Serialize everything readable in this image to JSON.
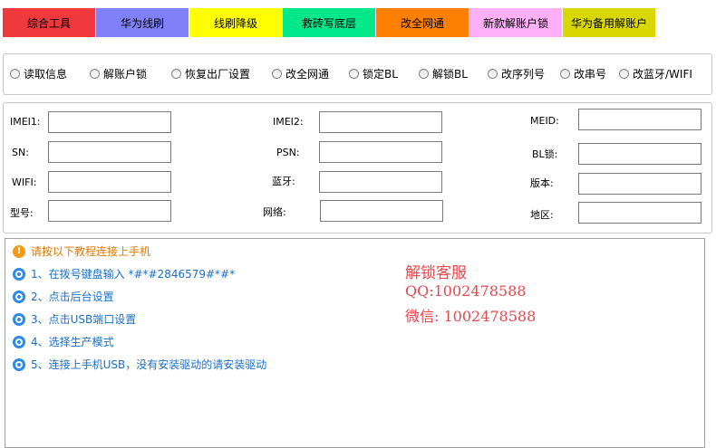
{
  "tabs": [
    {
      "label": "综合工具",
      "color": "#f0393c"
    },
    {
      "label": "华为线刷",
      "color": "#8080f8"
    },
    {
      "label": "线刷降级",
      "color": "#ffff00"
    },
    {
      "label": "救砖写底层",
      "color": "#00e88a"
    },
    {
      "label": "改全网通",
      "color": "#ff8000"
    },
    {
      "label": "新款解账户锁",
      "color": "#ffb0f8"
    },
    {
      "label": "华为备用解账户",
      "color": "#d8d800"
    }
  ],
  "options": [
    "读取信息",
    "解账户锁",
    "恢复出厂设置",
    "改全网通",
    "锁定BL",
    "解锁BL",
    "改序列号",
    "改串号",
    "改蓝牙/WIFI"
  ],
  "fields": {
    "imei1": {
      "label": "IMEI1:",
      "value": ""
    },
    "imei2": {
      "label": "IMEI2:",
      "value": ""
    },
    "meid": {
      "label": "MEID:",
      "value": ""
    },
    "sn": {
      "label": "SN:",
      "value": ""
    },
    "psn": {
      "label": "PSN:",
      "value": ""
    },
    "bl_lock": {
      "label": "BL锁:",
      "value": ""
    },
    "wifi": {
      "label": "WIFI:",
      "value": ""
    },
    "bluetooth": {
      "label": "蓝牙:",
      "value": ""
    },
    "version": {
      "label": "版本:",
      "value": ""
    },
    "model": {
      "label": "型号:",
      "value": ""
    },
    "network": {
      "label": "网络:",
      "value": ""
    },
    "region": {
      "label": "地区:",
      "value": ""
    }
  },
  "log": {
    "warning": "请按以下教程连接上手机",
    "steps": [
      "1、在拨号键盘输入 *#*#2846579#*#*",
      "2、点击后台设置",
      "3、点击USB端口设置",
      "4、选择生产模式",
      "5、连接上手机USB，没有安装驱动的请安装驱动"
    ],
    "contact": {
      "title": "解锁客服",
      "qq": "QQ:1002478588",
      "wechat": "微信: 1002478588"
    }
  },
  "colors": {
    "warn_text": "#e07800",
    "step_text": "#1a6fc4",
    "contact_text": "#e8474e",
    "step_icon": "#2c8ae8",
    "warn_icon": "#f29a18"
  }
}
